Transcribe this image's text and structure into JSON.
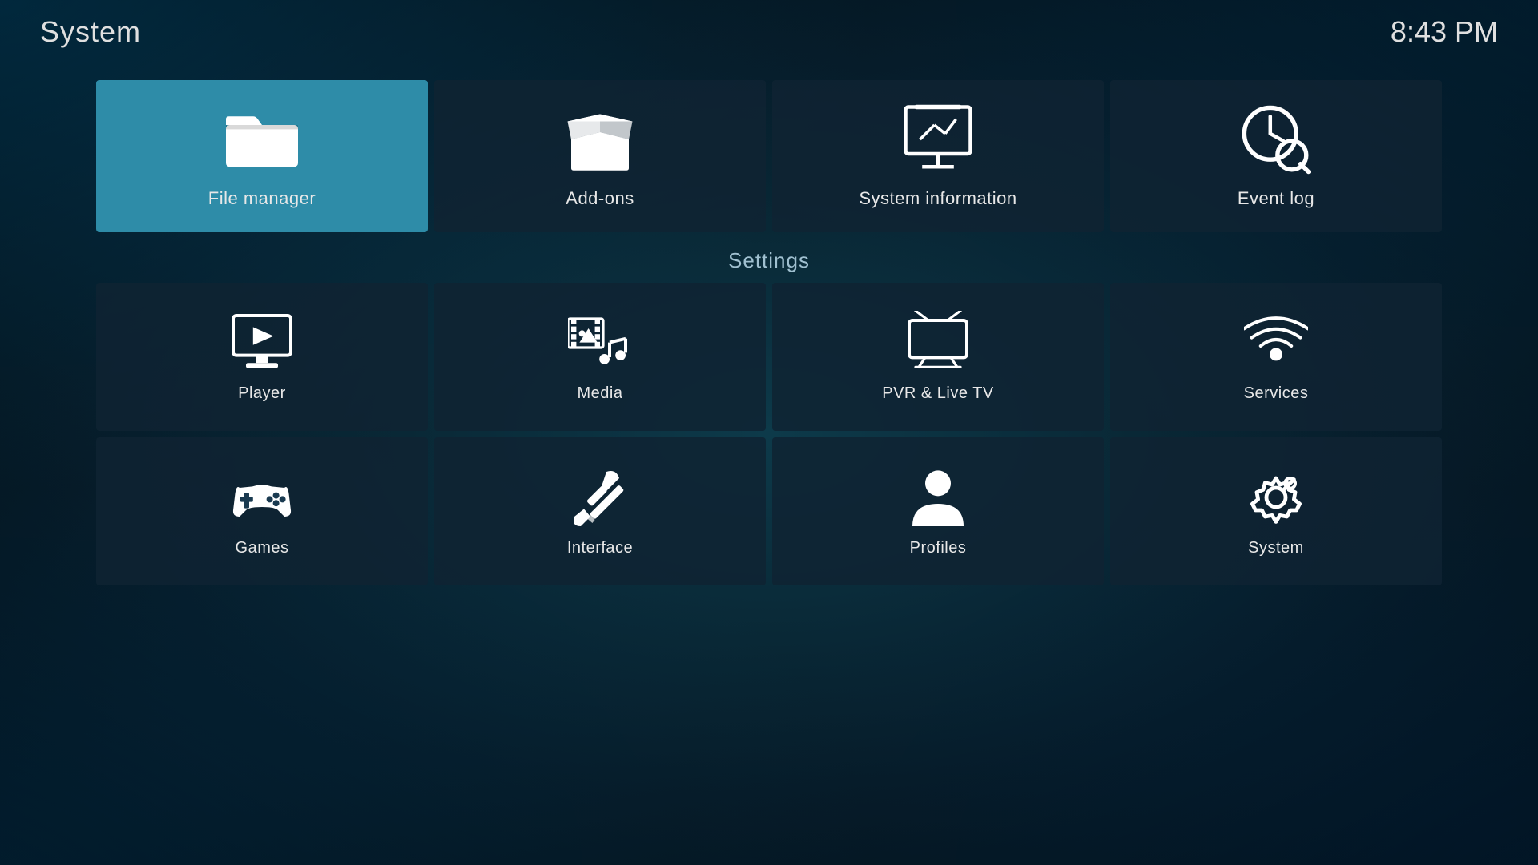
{
  "header": {
    "title": "System",
    "time": "8:43 PM"
  },
  "top_row": [
    {
      "id": "file-manager",
      "label": "File manager",
      "active": true,
      "icon": "folder"
    },
    {
      "id": "add-ons",
      "label": "Add-ons",
      "active": false,
      "icon": "box"
    },
    {
      "id": "system-information",
      "label": "System information",
      "active": false,
      "icon": "presentation"
    },
    {
      "id": "event-log",
      "label": "Event log",
      "active": false,
      "icon": "clock-search"
    }
  ],
  "settings": {
    "title": "Settings",
    "rows": [
      [
        {
          "id": "player",
          "label": "Player",
          "icon": "player"
        },
        {
          "id": "media",
          "label": "Media",
          "icon": "media"
        },
        {
          "id": "pvr-live-tv",
          "label": "PVR & Live TV",
          "icon": "tv"
        },
        {
          "id": "services",
          "label": "Services",
          "icon": "services"
        }
      ],
      [
        {
          "id": "games",
          "label": "Games",
          "icon": "games"
        },
        {
          "id": "interface",
          "label": "Interface",
          "icon": "interface"
        },
        {
          "id": "profiles",
          "label": "Profiles",
          "icon": "profiles"
        },
        {
          "id": "system",
          "label": "System",
          "icon": "system"
        }
      ]
    ]
  }
}
